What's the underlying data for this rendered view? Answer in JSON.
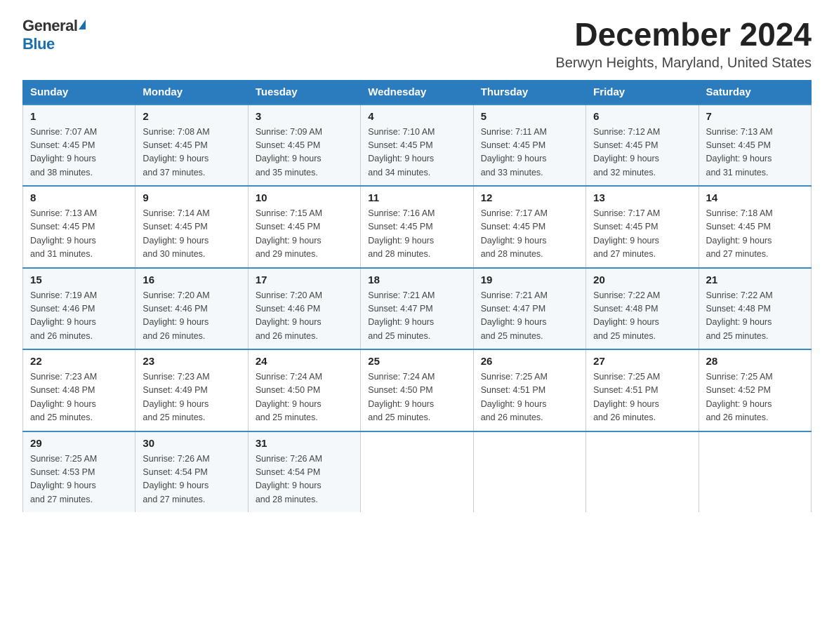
{
  "logo": {
    "general": "General",
    "blue": "Blue"
  },
  "title": "December 2024",
  "location": "Berwyn Heights, Maryland, United States",
  "days_of_week": [
    "Sunday",
    "Monday",
    "Tuesday",
    "Wednesday",
    "Thursday",
    "Friday",
    "Saturday"
  ],
  "weeks": [
    [
      {
        "day": "1",
        "sunrise": "7:07 AM",
        "sunset": "4:45 PM",
        "daylight": "9 hours and 38 minutes."
      },
      {
        "day": "2",
        "sunrise": "7:08 AM",
        "sunset": "4:45 PM",
        "daylight": "9 hours and 37 minutes."
      },
      {
        "day": "3",
        "sunrise": "7:09 AM",
        "sunset": "4:45 PM",
        "daylight": "9 hours and 35 minutes."
      },
      {
        "day": "4",
        "sunrise": "7:10 AM",
        "sunset": "4:45 PM",
        "daylight": "9 hours and 34 minutes."
      },
      {
        "day": "5",
        "sunrise": "7:11 AM",
        "sunset": "4:45 PM",
        "daylight": "9 hours and 33 minutes."
      },
      {
        "day": "6",
        "sunrise": "7:12 AM",
        "sunset": "4:45 PM",
        "daylight": "9 hours and 32 minutes."
      },
      {
        "day": "7",
        "sunrise": "7:13 AM",
        "sunset": "4:45 PM",
        "daylight": "9 hours and 31 minutes."
      }
    ],
    [
      {
        "day": "8",
        "sunrise": "7:13 AM",
        "sunset": "4:45 PM",
        "daylight": "9 hours and 31 minutes."
      },
      {
        "day": "9",
        "sunrise": "7:14 AM",
        "sunset": "4:45 PM",
        "daylight": "9 hours and 30 minutes."
      },
      {
        "day": "10",
        "sunrise": "7:15 AM",
        "sunset": "4:45 PM",
        "daylight": "9 hours and 29 minutes."
      },
      {
        "day": "11",
        "sunrise": "7:16 AM",
        "sunset": "4:45 PM",
        "daylight": "9 hours and 28 minutes."
      },
      {
        "day": "12",
        "sunrise": "7:17 AM",
        "sunset": "4:45 PM",
        "daylight": "9 hours and 28 minutes."
      },
      {
        "day": "13",
        "sunrise": "7:17 AM",
        "sunset": "4:45 PM",
        "daylight": "9 hours and 27 minutes."
      },
      {
        "day": "14",
        "sunrise": "7:18 AM",
        "sunset": "4:45 PM",
        "daylight": "9 hours and 27 minutes."
      }
    ],
    [
      {
        "day": "15",
        "sunrise": "7:19 AM",
        "sunset": "4:46 PM",
        "daylight": "9 hours and 26 minutes."
      },
      {
        "day": "16",
        "sunrise": "7:20 AM",
        "sunset": "4:46 PM",
        "daylight": "9 hours and 26 minutes."
      },
      {
        "day": "17",
        "sunrise": "7:20 AM",
        "sunset": "4:46 PM",
        "daylight": "9 hours and 26 minutes."
      },
      {
        "day": "18",
        "sunrise": "7:21 AM",
        "sunset": "4:47 PM",
        "daylight": "9 hours and 25 minutes."
      },
      {
        "day": "19",
        "sunrise": "7:21 AM",
        "sunset": "4:47 PM",
        "daylight": "9 hours and 25 minutes."
      },
      {
        "day": "20",
        "sunrise": "7:22 AM",
        "sunset": "4:48 PM",
        "daylight": "9 hours and 25 minutes."
      },
      {
        "day": "21",
        "sunrise": "7:22 AM",
        "sunset": "4:48 PM",
        "daylight": "9 hours and 25 minutes."
      }
    ],
    [
      {
        "day": "22",
        "sunrise": "7:23 AM",
        "sunset": "4:48 PM",
        "daylight": "9 hours and 25 minutes."
      },
      {
        "day": "23",
        "sunrise": "7:23 AM",
        "sunset": "4:49 PM",
        "daylight": "9 hours and 25 minutes."
      },
      {
        "day": "24",
        "sunrise": "7:24 AM",
        "sunset": "4:50 PM",
        "daylight": "9 hours and 25 minutes."
      },
      {
        "day": "25",
        "sunrise": "7:24 AM",
        "sunset": "4:50 PM",
        "daylight": "9 hours and 25 minutes."
      },
      {
        "day": "26",
        "sunrise": "7:25 AM",
        "sunset": "4:51 PM",
        "daylight": "9 hours and 26 minutes."
      },
      {
        "day": "27",
        "sunrise": "7:25 AM",
        "sunset": "4:51 PM",
        "daylight": "9 hours and 26 minutes."
      },
      {
        "day": "28",
        "sunrise": "7:25 AM",
        "sunset": "4:52 PM",
        "daylight": "9 hours and 26 minutes."
      }
    ],
    [
      {
        "day": "29",
        "sunrise": "7:25 AM",
        "sunset": "4:53 PM",
        "daylight": "9 hours and 27 minutes."
      },
      {
        "day": "30",
        "sunrise": "7:26 AM",
        "sunset": "4:54 PM",
        "daylight": "9 hours and 27 minutes."
      },
      {
        "day": "31",
        "sunrise": "7:26 AM",
        "sunset": "4:54 PM",
        "daylight": "9 hours and 28 minutes."
      },
      null,
      null,
      null,
      null
    ]
  ],
  "labels": {
    "sunrise": "Sunrise:",
    "sunset": "Sunset:",
    "daylight": "Daylight:"
  },
  "colors": {
    "header_bg": "#2b7bbf",
    "accent": "#1a6faf"
  }
}
